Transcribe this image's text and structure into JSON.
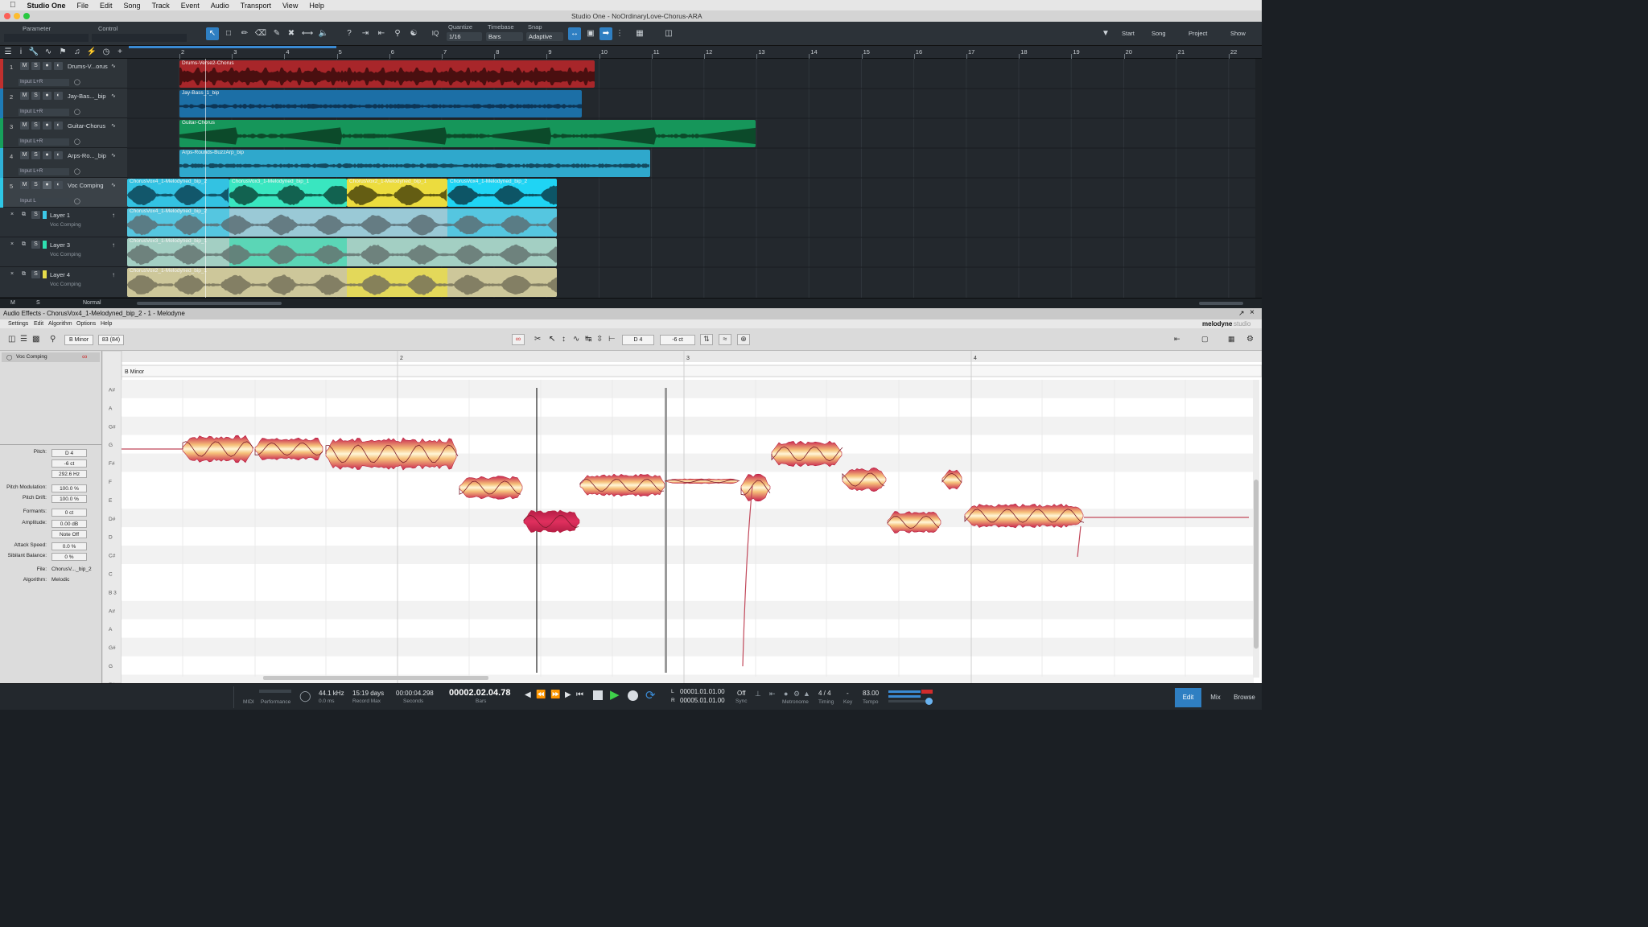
{
  "menubar": {
    "app": "Studio One",
    "items": [
      "File",
      "Edit",
      "Song",
      "Track",
      "Event",
      "Audio",
      "Transport",
      "View",
      "Help"
    ]
  },
  "window": {
    "title": "Studio One - NoOrdinaryLove-Chorus-ARA"
  },
  "toolbar": {
    "parameter_label": "Parameter",
    "control_label": "Control",
    "quantize_label": "Quantize",
    "quantize_value": "1/16",
    "timebase_label": "Timebase",
    "timebase_value": "Bars",
    "snap_label": "Snap",
    "snap_value": "Adaptive",
    "iq_label": "IQ",
    "start_label": "Start",
    "song_label": "Song",
    "project_label": "Project",
    "show_label": "Show"
  },
  "ruler": {
    "bars": [
      "2",
      "3",
      "4",
      "5",
      "6",
      "7",
      "8",
      "9",
      "10",
      "11",
      "12",
      "13",
      "14",
      "15",
      "16",
      "17",
      "18",
      "19",
      "20",
      "21",
      "22"
    ]
  },
  "tracks": [
    {
      "num": "1",
      "name": "Drums-V...orus",
      "input": "Input L+R",
      "color": "#c0302e"
    },
    {
      "num": "2",
      "name": "Jay-Bas..._bip",
      "input": "Input L+R",
      "color": "#1e7bb6"
    },
    {
      "num": "3",
      "name": "Guitar-Chorus",
      "input": "Input L+R",
      "color": "#17a05b"
    },
    {
      "num": "4",
      "name": "Arps-Ro..._bip",
      "input": "Input L+R",
      "color": "#2fb0d6"
    },
    {
      "num": "5",
      "name": "Voc Comping",
      "input": "Input L",
      "color": "#2ec7e6"
    }
  ],
  "layers": [
    {
      "name": "Layer 1",
      "sub": "Voc Comping",
      "color": "#3cc9e8"
    },
    {
      "name": "Layer 3",
      "sub": "Voc Comping",
      "color": "#2ee0b0"
    },
    {
      "name": "Layer 4",
      "sub": "Voc Comping",
      "color": "#e6dc4a"
    }
  ],
  "track_buttons": {
    "m": "M",
    "s": "S"
  },
  "clips": {
    "drums": "Drums-Verse2-Chorus",
    "bass": "Jay-Bass_1_bip",
    "guitar": "Guitar-Chorus",
    "arps": "Arps-Rounds-BuzzArp_bip",
    "voc1": "ChorusVox4_1-Melodyned_bip_2",
    "voc2": "ChorusVox3_1-Melodyned_bip_1",
    "voc3": "ChorusVox2_1-Melodyned_bip_1",
    "voc4": "ChorusVox4_1-Melodyned_bip_2"
  },
  "footer": {
    "m": "M",
    "s": "S",
    "mode": "Normal"
  },
  "audio_effects": {
    "title": "Audio Effects - ChorusVox4_1-Melodyned_bip_2 - 1 - Melodyne"
  },
  "melodyne": {
    "menu": [
      "Settings",
      "Edit",
      "Algorithm",
      "Options",
      "Help"
    ],
    "brand": "melodyne",
    "brand2": "studio",
    "key": "B Minor",
    "tempo_field": "83 (84)",
    "pitch_field": "D 4",
    "cents_field": "-6 ct",
    "track_name": "Voc Comping",
    "key_lane": "B Minor",
    "bars": [
      "2",
      "3",
      "4"
    ],
    "note_names": [
      "A#",
      "A",
      "G#",
      "G",
      "F#",
      "F",
      "E",
      "D#",
      "D",
      "C#",
      "C",
      "B 3",
      "A#",
      "A",
      "G#",
      "G",
      "F#"
    ],
    "params": {
      "pitch_label": "Pitch:",
      "pitch": "D 4",
      "cents": "-6 ct",
      "hz": "292.6 Hz",
      "pitch_mod_label": "Pitch Modulation:",
      "pitch_mod": "100.0 %",
      "pitch_drift_label": "Pitch Drift:",
      "pitch_drift": "100.0 %",
      "formants_label": "Formants:",
      "formants": "0 ct",
      "amplitude_label": "Amplitude:",
      "amplitude": "0.00 dB",
      "note_off": "Note Off",
      "attack_label": "Attack Speed:",
      "attack": "0.0 %",
      "sibilant_label": "Sibilant Balance:",
      "sibilant": "0 %",
      "file_label": "File:",
      "file": "ChorusV..._bip_2",
      "algorithm_label": "Algorithm:",
      "algorithm": "Melodic"
    }
  },
  "transport": {
    "midi": "MIDI",
    "performance": "Performance",
    "rate": "44.1 kHz",
    "rate_sub": "0.0 ms",
    "rec_days": "15:19 days",
    "rec_label": "Record Max",
    "seconds": "00:00:04.298",
    "seconds_label": "Seconds",
    "bars": "00002.02.04.78",
    "bars_label": "Bars",
    "loop_l": "00001.01.01.00",
    "loop_r": "00005.01.01.00",
    "l": "L",
    "r": "R",
    "sync": "Off",
    "sync_label": "Sync",
    "metronome_label": "Metronome",
    "timing": "4 / 4",
    "timing_label": "Timing",
    "key": "-",
    "key_label": "Key",
    "tempo": "83.00",
    "tempo_label": "Tempo",
    "edit": "Edit",
    "mix": "Mix",
    "browse": "Browse"
  }
}
